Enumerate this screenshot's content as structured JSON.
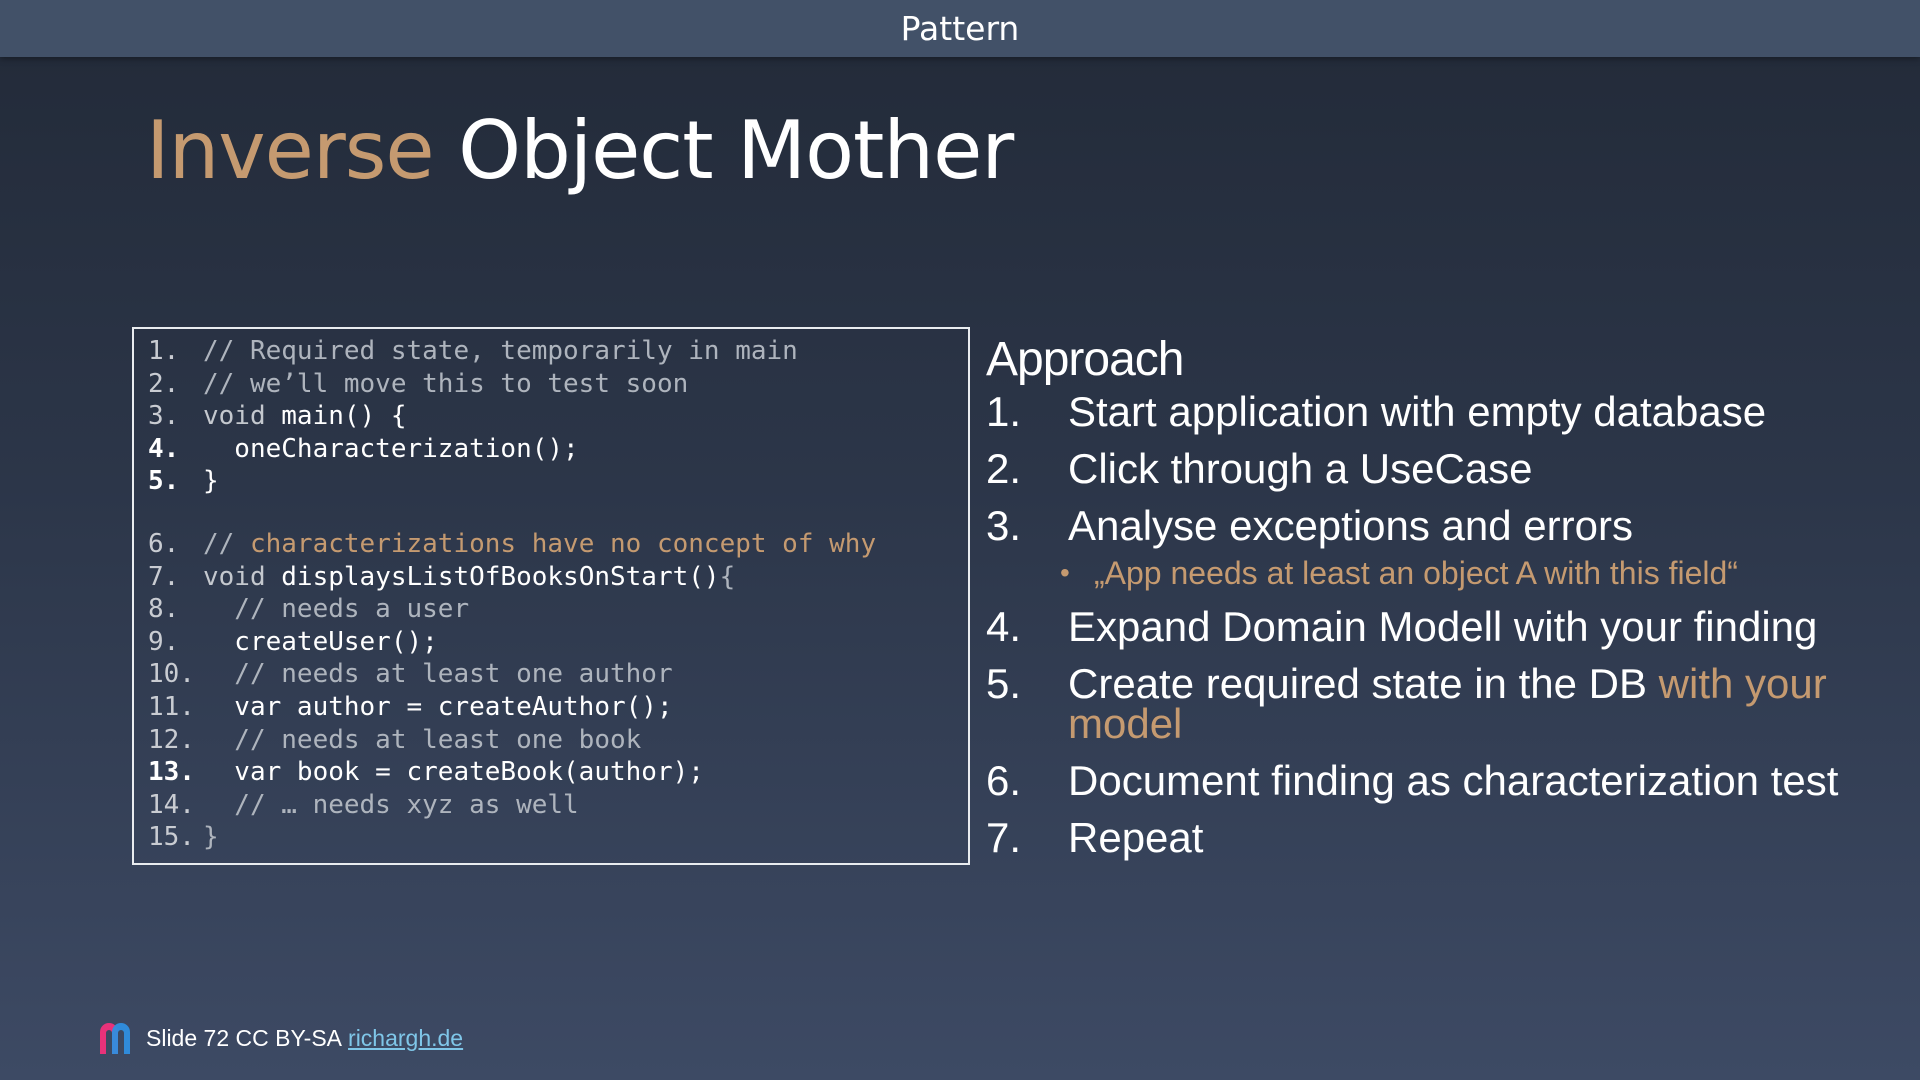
{
  "header": {
    "title": "Pattern"
  },
  "slide": {
    "title_accent": "Inverse",
    "title_rest": "Object Mother"
  },
  "code": {
    "lines": [
      {
        "num": "1.",
        "parts": [
          {
            "t": "// Required state, temporarily in main",
            "c": "comment"
          }
        ]
      },
      {
        "num": "2.",
        "parts": [
          {
            "t": "// we’ll move this to test soon",
            "c": "comment"
          }
        ]
      },
      {
        "num": "3.",
        "parts": [
          {
            "t": "void ",
            "c": "key"
          },
          {
            "t": "main() {",
            "c": "plain"
          }
        ]
      },
      {
        "num": "4.",
        "bold": true,
        "parts": [
          {
            "t": "  oneCharacterization();",
            "c": "plain"
          }
        ]
      },
      {
        "num": "5.",
        "bold": true,
        "parts": [
          {
            "t": "}",
            "c": "plain"
          }
        ]
      },
      {
        "num": "6.",
        "gap": true,
        "parts": [
          {
            "t": "// ",
            "c": "comment"
          },
          {
            "t": "characterizations have no concept of why",
            "c": "orange"
          }
        ]
      },
      {
        "num": "7.",
        "parts": [
          {
            "t": "void ",
            "c": "key"
          },
          {
            "t": "displaysListOfBooksOnStart()",
            "c": "plain"
          },
          {
            "t": "{",
            "c": "gray"
          }
        ]
      },
      {
        "num": "8.",
        "parts": [
          {
            "t": "  // needs a user",
            "c": "comment"
          }
        ]
      },
      {
        "num": "9.",
        "parts": [
          {
            "t": "  createUser();",
            "c": "plain"
          }
        ]
      },
      {
        "num": "10.",
        "parts": [
          {
            "t": "  // needs at least one author",
            "c": "comment"
          }
        ]
      },
      {
        "num": "11.",
        "parts": [
          {
            "t": "  var author = createAuthor();",
            "c": "plain"
          }
        ]
      },
      {
        "num": "12.",
        "parts": [
          {
            "t": "  // needs at least one book",
            "c": "comment"
          }
        ]
      },
      {
        "num": "13.",
        "bold": true,
        "parts": [
          {
            "t": "  var book = createBook(author);",
            "c": "plain"
          }
        ]
      },
      {
        "num": "14.",
        "parts": [
          {
            "t": "  // … needs xyz as well",
            "c": "comment"
          }
        ]
      },
      {
        "num": "15.",
        "parts": [
          {
            "t": "}",
            "c": "gray"
          }
        ]
      }
    ]
  },
  "approach": {
    "heading": "Approach",
    "steps": [
      {
        "num": "1.",
        "text": "Start application with empty database"
      },
      {
        "num": "2.",
        "text": "Click through a UseCase"
      },
      {
        "num": "3.",
        "text": "Analyse exceptions and errors",
        "sub": "„App needs at least an object A with this field“"
      },
      {
        "num": "4.",
        "text": "Expand Domain Modell with your finding"
      },
      {
        "num": "5.",
        "text": "Create required state in the DB ",
        "highlight": "with your model"
      },
      {
        "num": "6.",
        "text": "Document finding as characterization test"
      },
      {
        "num": "7.",
        "text": "Repeat"
      }
    ]
  },
  "footer": {
    "text": "Slide 72 CC BY-SA",
    "link": "richargh.de"
  },
  "colors": {
    "accent": "#c59a70",
    "link": "#7fc6e8",
    "header_bg": "#425168"
  }
}
